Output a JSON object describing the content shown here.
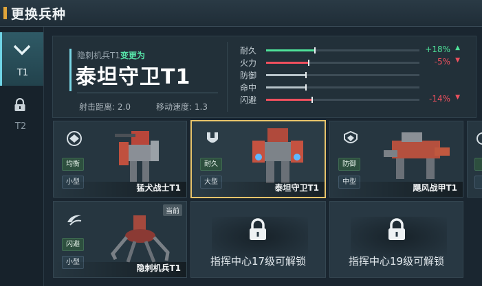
{
  "window": {
    "title": "更换兵种"
  },
  "tabs": [
    {
      "label": "T1",
      "icon": "chevron-down-icon",
      "active": true
    },
    {
      "label": "T2",
      "icon": "lock-icon",
      "locked": true
    }
  ],
  "info": {
    "from_text": "隐刺机兵T1",
    "change_text": "变更为",
    "unit_name": "泰坦守卫T1",
    "range_label": "射击距离:",
    "range_value": "2.0",
    "speed_label": "移动速度:",
    "speed_value": "1.3"
  },
  "stats": [
    {
      "name": "耐久",
      "base": 0.32,
      "change": 0.18,
      "pct": "+18%",
      "dir": "up"
    },
    {
      "name": "火力",
      "base": 0.28,
      "change": -0.05,
      "pct": "-5%",
      "dir": "down"
    },
    {
      "name": "防御",
      "base": 0.26,
      "change": 0,
      "pct": "",
      "dir": ""
    },
    {
      "name": "命中",
      "base": 0.26,
      "change": 0,
      "pct": "",
      "dir": ""
    },
    {
      "name": "闪避",
      "base": 0.3,
      "change": -0.14,
      "pct": "-14%",
      "dir": "down"
    }
  ],
  "units": [
    {
      "name": "猛犬战士T1",
      "role": "均衡",
      "size": "小型",
      "icon": "balance-class-icon",
      "selected": false,
      "current": false
    },
    {
      "name": "泰坦守卫T1",
      "role": "耐久",
      "size": "大型",
      "icon": "durability-class-icon",
      "selected": true,
      "current": false
    },
    {
      "name": "飓风战甲T1",
      "role": "防御",
      "size": "中型",
      "icon": "defense-class-icon",
      "selected": false,
      "current": false
    },
    {
      "name": "隐刺机兵T1",
      "role": "闪避",
      "size": "小型",
      "icon": "evasion-class-icon",
      "selected": false,
      "current": true,
      "current_label": "当前"
    }
  ],
  "locked_slots": [
    {
      "text": "指挥中心17级可解锁",
      "icon": "lock-icon"
    },
    {
      "text": "指挥中心19级可解锁",
      "icon": "lock-icon"
    }
  ],
  "colors": {
    "accent": "#7ad7e6",
    "positive": "#4fe39a",
    "negative": "#f0505e",
    "selected_border": "#e8c46a"
  }
}
